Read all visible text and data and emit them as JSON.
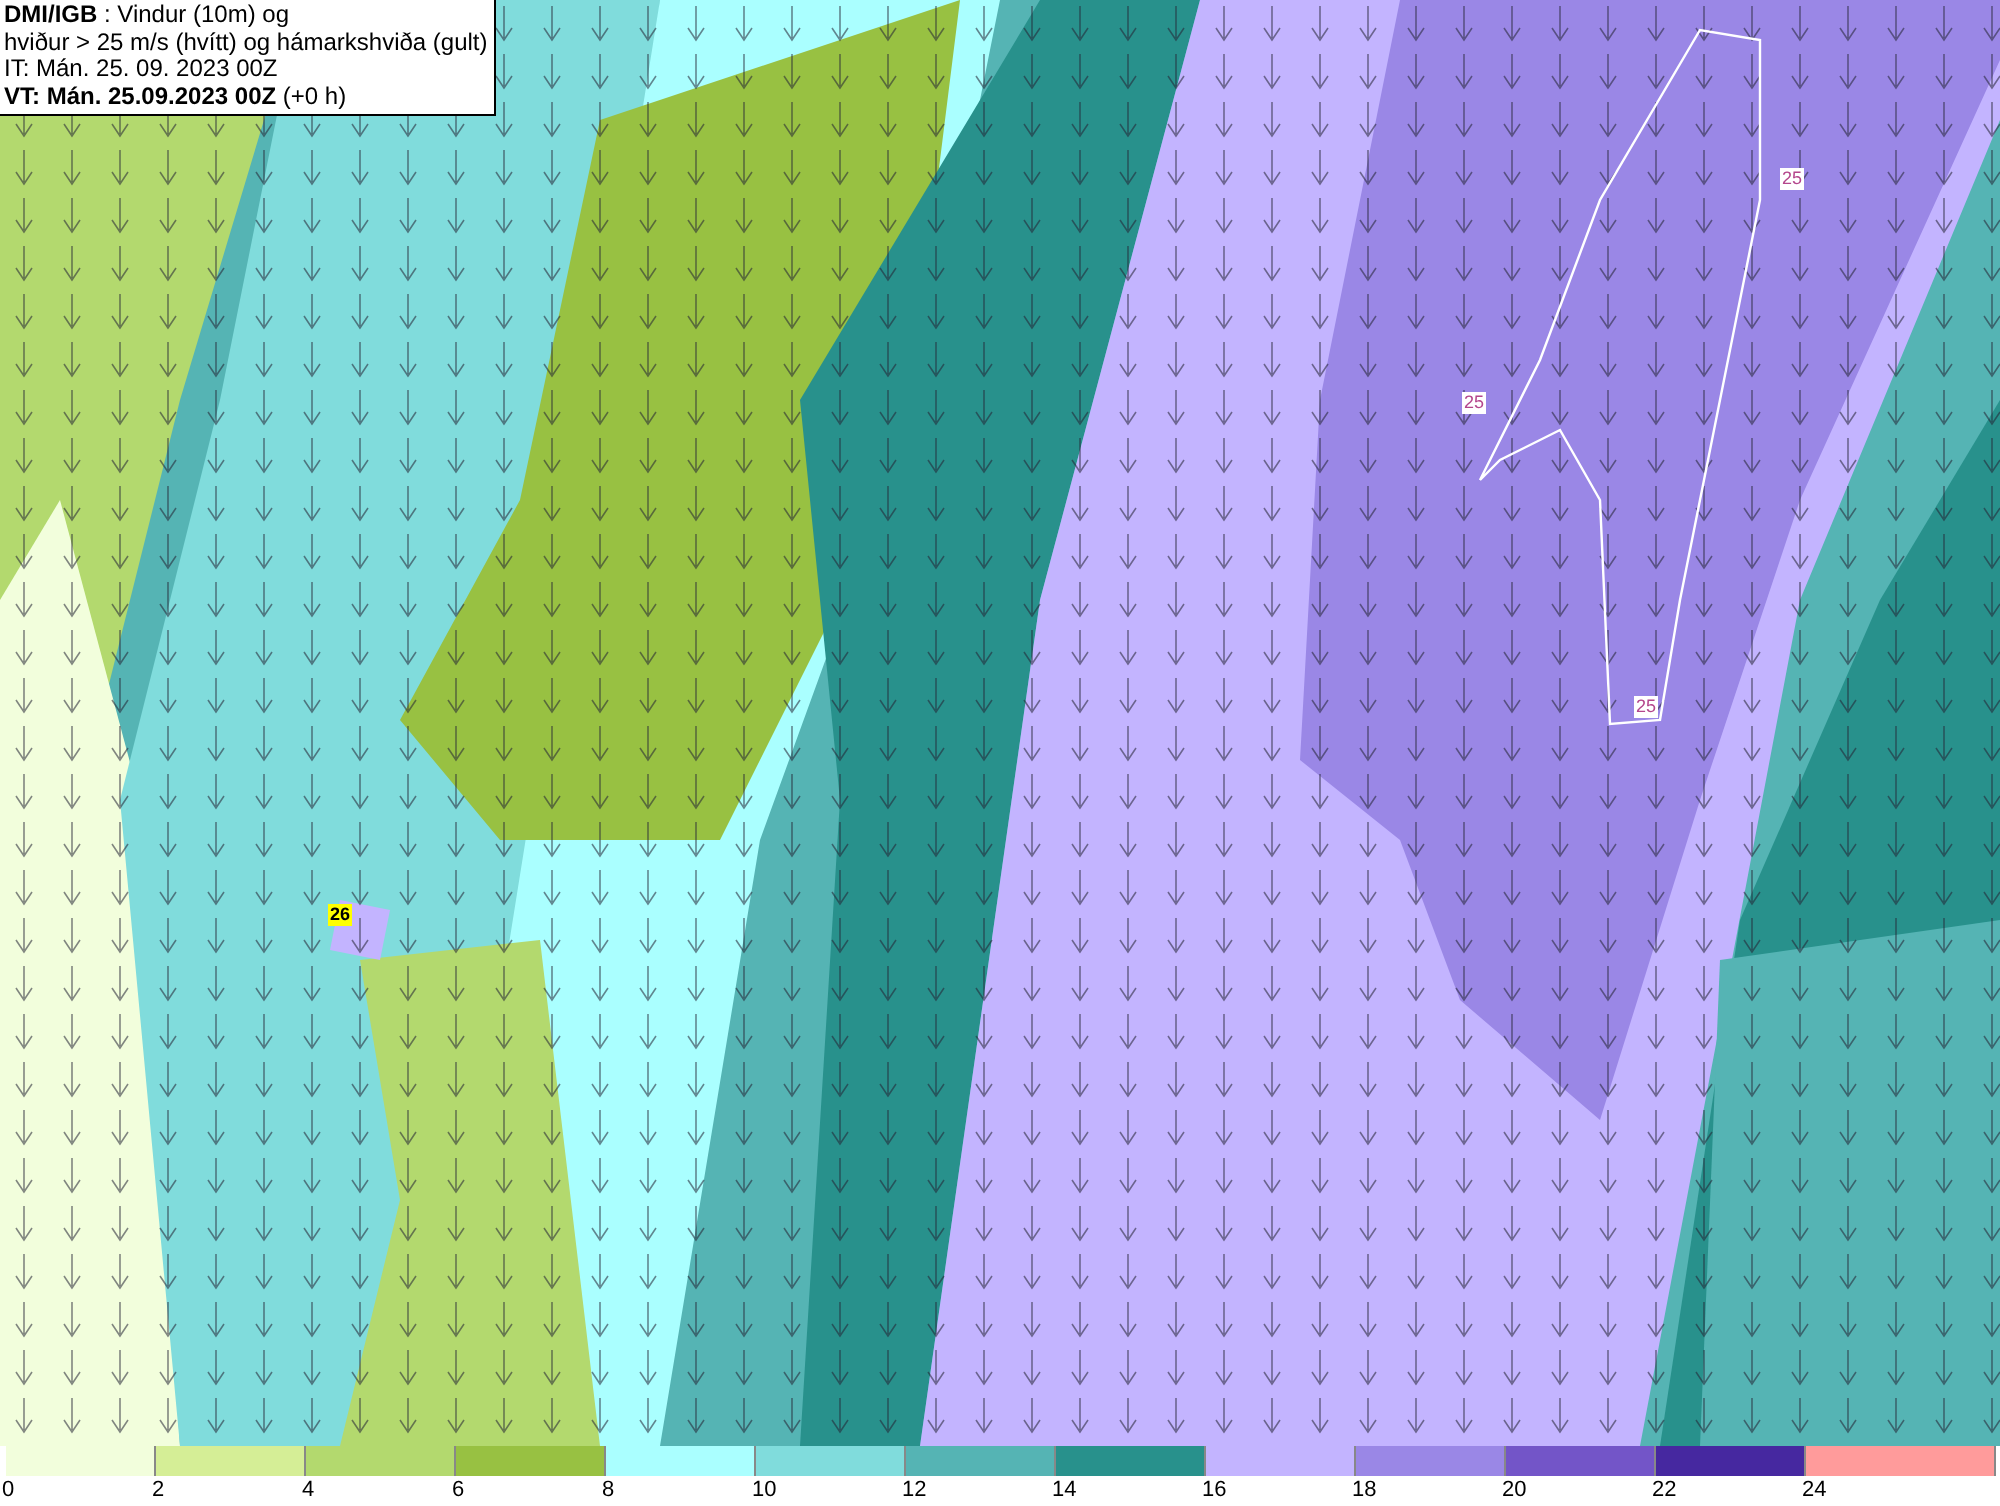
{
  "header": {
    "lines": [
      "**DMI/IGB** : Vindur (10m) og",
      "hviður > 25 m/s (hvítt) og hámarkshviða (gult)",
      "IT: Mán. 25. 09. 2023 00Z",
      "**VT: Mán. 25.09.2023 00Z** (+0 h)"
    ]
  },
  "map_labels": [
    {
      "text": "25",
      "kind": "gust"
    },
    {
      "text": "25",
      "kind": "gust"
    },
    {
      "text": "25",
      "kind": "gust"
    },
    {
      "text": "26",
      "kind": "max"
    }
  ],
  "legend": {
    "swatches": [
      {
        "color": "#f2fedc"
      },
      {
        "color": "#d5ee96"
      },
      {
        "color": "#b3d96e"
      },
      {
        "color": "#98c142"
      },
      {
        "color": "#aaffff"
      },
      {
        "color": "#80dcdc"
      },
      {
        "color": "#55b4b4"
      },
      {
        "color": "#28918c"
      },
      {
        "color": "#c3b4ff"
      },
      {
        "color": "#9a87e6"
      },
      {
        "color": "#7355c8"
      },
      {
        "color": "#4628a0"
      },
      {
        "color": "#ff9b9b"
      }
    ],
    "ticks": [
      "0",
      "2",
      "4",
      "6",
      "8",
      "10",
      "12",
      "14",
      "16",
      "18",
      "20",
      "22",
      "24"
    ]
  }
}
